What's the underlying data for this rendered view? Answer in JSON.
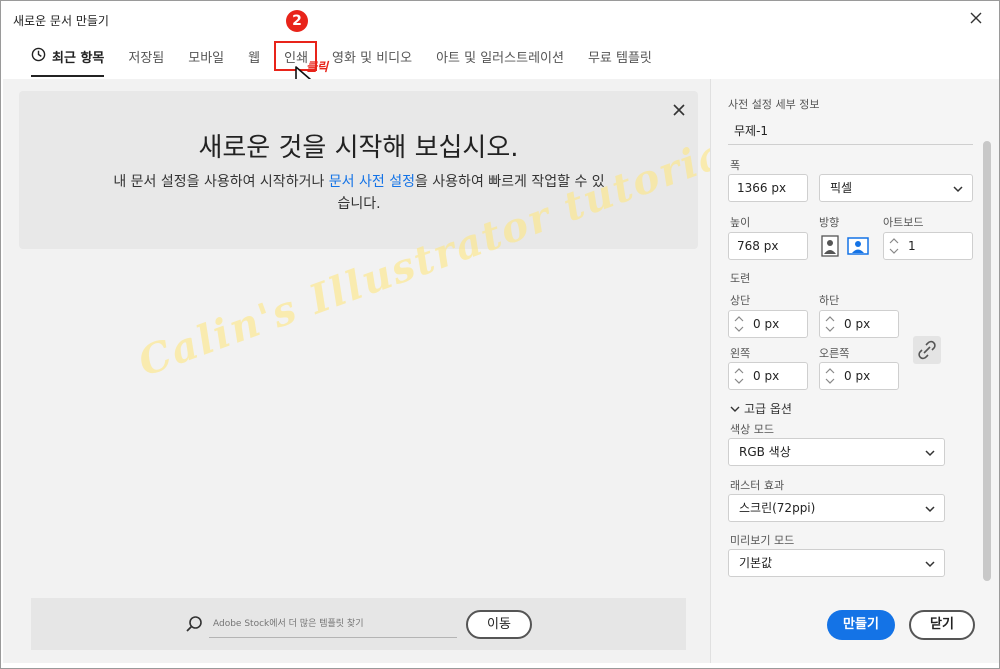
{
  "window": {
    "title": "새로운 문서 만들기"
  },
  "tabs": [
    {
      "label": "최근 항목",
      "active": true
    },
    {
      "label": "저장됨"
    },
    {
      "label": "모바일"
    },
    {
      "label": "웹"
    },
    {
      "label": "인쇄"
    },
    {
      "label": "영화 및 비디오"
    },
    {
      "label": "아트 및 일러스트레이션"
    },
    {
      "label": "무료 템플릿"
    }
  ],
  "annotation": {
    "step": "2",
    "click_text": "클릭"
  },
  "welcome": {
    "title": "새로운 것을 시작해 보십시오.",
    "desc_before": "내 문서 설정을 사용하여 시작하거나 ",
    "desc_link": "문서 사전 설정",
    "desc_after": "을 사용하여 빠르게 작업할 수 있습니다."
  },
  "watermark": "Calin's Illustrator tutorial",
  "search": {
    "placeholder": "Adobe Stock에서 더 많은 템플릿 찾기",
    "go_label": "이동"
  },
  "panel": {
    "heading": "사전 설정 세부 정보",
    "doc_name": "무제-1",
    "width_label": "폭",
    "width_value": "1366 px",
    "unit": "픽셀",
    "height_label": "높이",
    "height_value": "768 px",
    "orientation_label": "방향",
    "artboard_label": "아트보드",
    "artboard_value": "1",
    "bleed_label": "도련",
    "top_label": "상단",
    "top_value": "0 px",
    "bottom_label": "하단",
    "bottom_value": "0 px",
    "left_label": "왼쪽",
    "left_value": "0 px",
    "right_label": "오른쪽",
    "right_value": "0 px",
    "advanced_label": "고급 옵션",
    "color_mode_label": "색상 모드",
    "color_mode_value": "RGB 색상",
    "raster_label": "래스터 효과",
    "raster_value": "스크린(72ppi)",
    "preview_label": "미리보기 모드",
    "preview_value": "기본값"
  },
  "actions": {
    "create": "만들기",
    "close": "닫기"
  }
}
